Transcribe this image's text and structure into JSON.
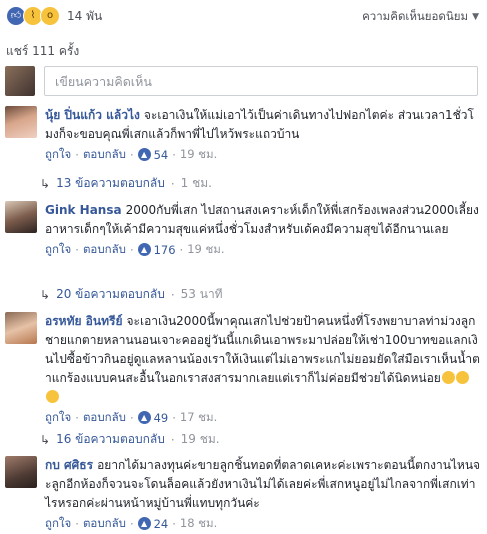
{
  "reactions": {
    "icons": [
      "like-icon",
      "haha-icon",
      "wow-icon"
    ],
    "count": "14 พัน"
  },
  "sort_label": "ความคิดเห็นยอดนิยม",
  "shares": "แชร์ 111 ครั้ง",
  "composer_placeholder": "เขียนความคิดเห็น",
  "comments": [
    {
      "author": "นุ้ย ปิ่นแก้ว แล้วไง",
      "text": "จะเอาเงินให้แม่เอาไว้เป็นค่าเดินทางไปฟอกไตค่ะ ส่วนเวลา1ชั่วโมงก็จะขอบคุณพี่เสกแล้วก็พาพี่ไปไหว้พระแถวบ้าน",
      "like": "ถูกใจ",
      "reply": "ตอบกลับ",
      "likes": "54",
      "time": "19 ชม.",
      "replies": "13 ข้อความตอบกลับ",
      "replies_time": "1 ชม."
    },
    {
      "author": "Gink Hansa",
      "text": "2000กับพี่เสก ไปสถานสงเคราะห์เด็กให้พี่เสกร้องเพลงส่วน2000เลี้ยงอาหารเด็กๆให้เค้ามีความสุขแค่หนึ่งชั่วโมงสำหรับเด้คงมีความสุขได้อีกนานเลย",
      "like": "ถูกใจ",
      "reply": "ตอบกลับ",
      "likes": "176",
      "time": "19 ชม.",
      "replies": "20 ข้อความตอบกลับ",
      "replies_time": "53 นาที"
    },
    {
      "author": "อรหทัย อินทรีย์",
      "text": "จะเอาเงิน2000นี้พาคุณเสกไปช่วยป้าคนหนึ่งที่โรงพยาบาลท่าม่วงลูกชายแกตายหลานนอนเจาะคออยู่วันนี้แกเดินเอาพระมาปล่อยให้เช่า100บาทขอแลกเงินไปซื้อข้าวกินอยู่ดูแลหลานน้องเราให้เงินแต่ไม่เอาพระแกไม่ยอมยัดใส่มือเราเห็นน้ำตาแกร้องแบบคนสะอื้นในอกเราสงสารมากเลยแต่เราก็ไม่ค่อยมีช่วยได้นิดหน่อย",
      "like": "ถูกใจ",
      "reply": "ตอบกลับ",
      "likes": "49",
      "time": "17 ชม.",
      "replies": "16 ข้อความตอบกลับ",
      "replies_time": "19 ชม."
    },
    {
      "author": "กบ ศศิธร",
      "text": "อยากได้มาลงทุนค่ะขายลูกชิ้นทอดที่ตลาดเคหะค่ะเพราะตอนนี้ตกงานไหนจะลูกอีกห้องก็จวนจะโดนล็อคแล้วยังหาเงินไม่ได้เลยค่ะพี่เสกหนูอยู่ไม่ไกลจากพี่เสกเท่าไรหรอกค่ะผ่านหน้าหมู่บ้านพี่แทบทุกวันค่ะ",
      "like": "ถูกใจ",
      "reply": "ตอบกลับ",
      "likes": "24",
      "time": "18 ชม."
    }
  ]
}
